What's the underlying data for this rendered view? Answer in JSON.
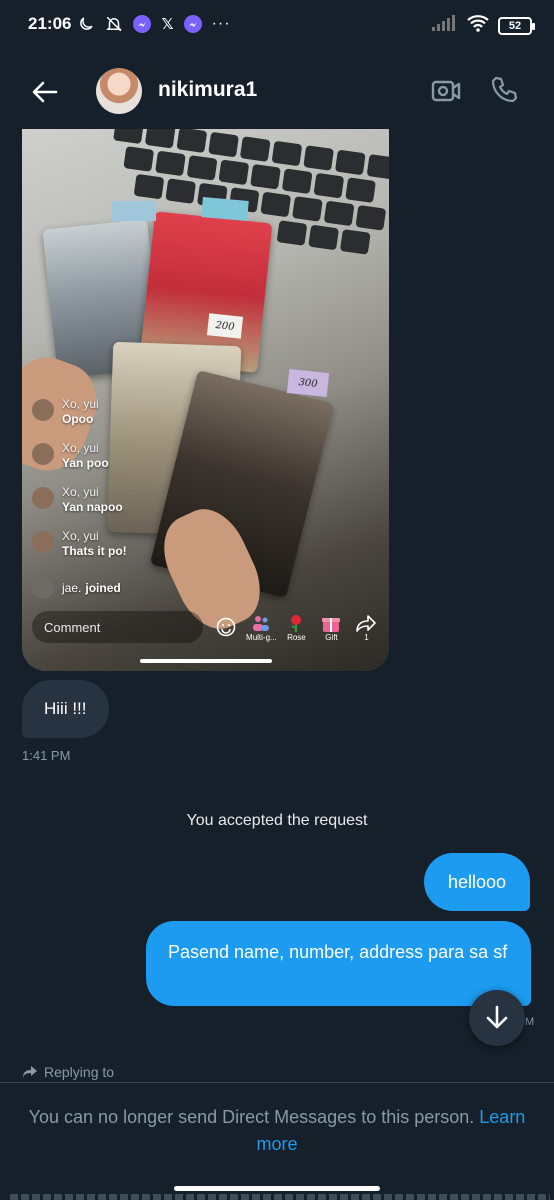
{
  "status_bar": {
    "time": "21:06",
    "battery": "52",
    "dots": "···",
    "x_app": "𝕏"
  },
  "header": {
    "username": "nikimura1"
  },
  "live_stream": {
    "comments": [
      {
        "name": "Xo, yui",
        "message": "Opoo"
      },
      {
        "name": "Xo, yui",
        "message": "Yan poo"
      },
      {
        "name": "Xo, yui",
        "message": "Yan napoo"
      },
      {
        "name": "Xo, yui",
        "message": "Thats it po!"
      }
    ],
    "join": {
      "name": "jae.",
      "action": "joined"
    },
    "comment_placeholder": "Comment",
    "actions": [
      {
        "label": "Multi-g..."
      },
      {
        "label": "Rose"
      },
      {
        "label": "Gift"
      },
      {
        "label": "1"
      }
    ],
    "price_tags": [
      "200",
      "300"
    ]
  },
  "messages": {
    "incoming": "Hiii !!!",
    "incoming_time": "1:41 PM",
    "system": "You accepted the request",
    "outgoing_1": "hellooo",
    "outgoing_2": "Pasend name, number, address para sa sf",
    "outgoing_meta": "M"
  },
  "footer": {
    "replying_to": "Replying to",
    "notice": "You can no longer send Direct Messages to this person.",
    "learn_more": "Learn more"
  },
  "colors": {
    "background": "#15202b",
    "accent": "#1d9bf0",
    "incoming_bubble": "#273340",
    "muted_text": "#8b98a5"
  }
}
